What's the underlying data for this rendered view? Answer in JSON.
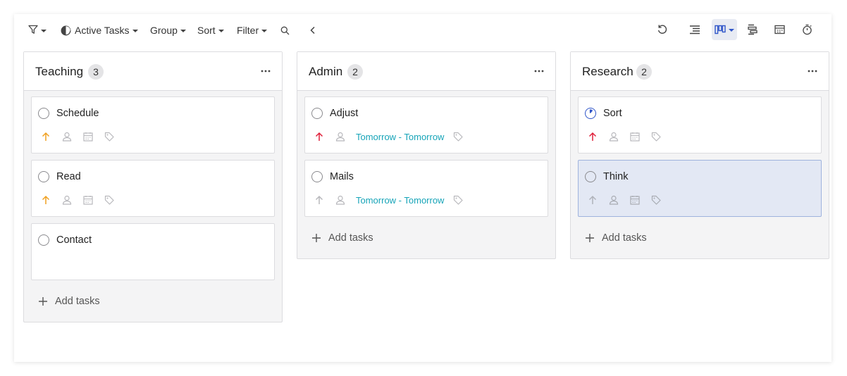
{
  "toolbar": {
    "active_tasks": "Active Tasks",
    "group": "Group",
    "sort": "Sort",
    "filter": "Filter"
  },
  "colors": {
    "priority_high": "#e0213b",
    "priority_medium": "#f0a020",
    "priority_none": "#b8b8bc",
    "date_text": "#16a4b8",
    "selected_card": "#e3e8f4",
    "accent": "#2f55c9"
  },
  "columns": [
    {
      "title": "Teaching",
      "count": "3",
      "add_label": "Add tasks",
      "cards": [
        {
          "title": "Schedule",
          "priority": "medium",
          "date": ""
        },
        {
          "title": "Read",
          "priority": "medium",
          "date": ""
        },
        {
          "title": "Contact",
          "priority": "",
          "date": ""
        }
      ]
    },
    {
      "title": "Admin",
      "count": "2",
      "add_label": "Add tasks",
      "cards": [
        {
          "title": "Adjust",
          "priority": "high",
          "date": "Tomorrow - Tomorrow"
        },
        {
          "title": "Mails",
          "priority": "none",
          "date": "Tomorrow - Tomorrow"
        }
      ]
    },
    {
      "title": "Research",
      "count": "2",
      "add_label": "Add tasks",
      "cards": [
        {
          "title": "Sort",
          "priority": "high",
          "date": "",
          "status": "in-progress"
        },
        {
          "title": "Think",
          "priority": "none",
          "date": "",
          "selected": true
        }
      ]
    }
  ],
  "icons": {
    "filter": "filter-icon",
    "pie": "pie-chart-icon",
    "search": "search-icon",
    "collapse": "chevron-left-icon",
    "undo": "undo-icon",
    "list_view": "list-view-icon",
    "board_view": "board-view-icon",
    "gantt_view": "gantt-view-icon",
    "calendar_view": "calendar-view-icon",
    "timer": "timer-icon"
  }
}
